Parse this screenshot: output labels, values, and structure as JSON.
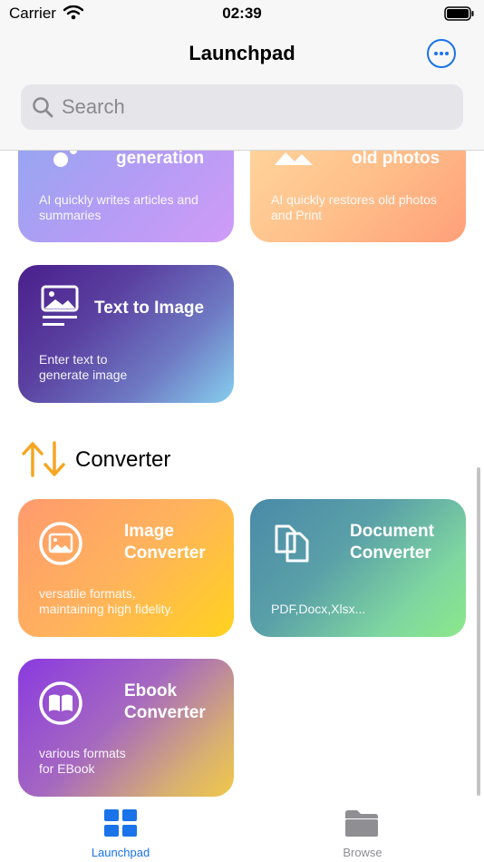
{
  "status": {
    "carrier": "Carrier",
    "time": "02:39"
  },
  "nav": {
    "title": "Launchpad"
  },
  "search": {
    "placeholder": "Search"
  },
  "cards_top": [
    {
      "title": "generation",
      "desc": "AI quickly writes articles and summaries"
    },
    {
      "title": "old photos",
      "desc": "AI quickly restores old photos and Print"
    }
  ],
  "text_to_image": {
    "title": "Text to Image",
    "desc_line1": "Enter text to",
    "desc_line2": "generate image"
  },
  "section": {
    "title": "Converter"
  },
  "converters": [
    {
      "title1": "Image",
      "title2": "Converter",
      "desc_line1": "versatile formats,",
      "desc_line2": "maintaining high fidelity."
    },
    {
      "title1": "Document",
      "title2": "Converter",
      "desc_line1": "PDF,Docx,Xlsx...",
      "desc_line2": ""
    },
    {
      "title1": "Ebook",
      "title2": "Converter",
      "desc_line1": "various formats",
      "desc_line2": "for EBook"
    }
  ],
  "tabs": [
    {
      "label": "Launchpad",
      "color": "#1a73e8"
    },
    {
      "label": "Browse",
      "color": "#8e8e93"
    }
  ],
  "colors": {
    "accent": "#1a73e8",
    "arrows": "#f5a623"
  }
}
